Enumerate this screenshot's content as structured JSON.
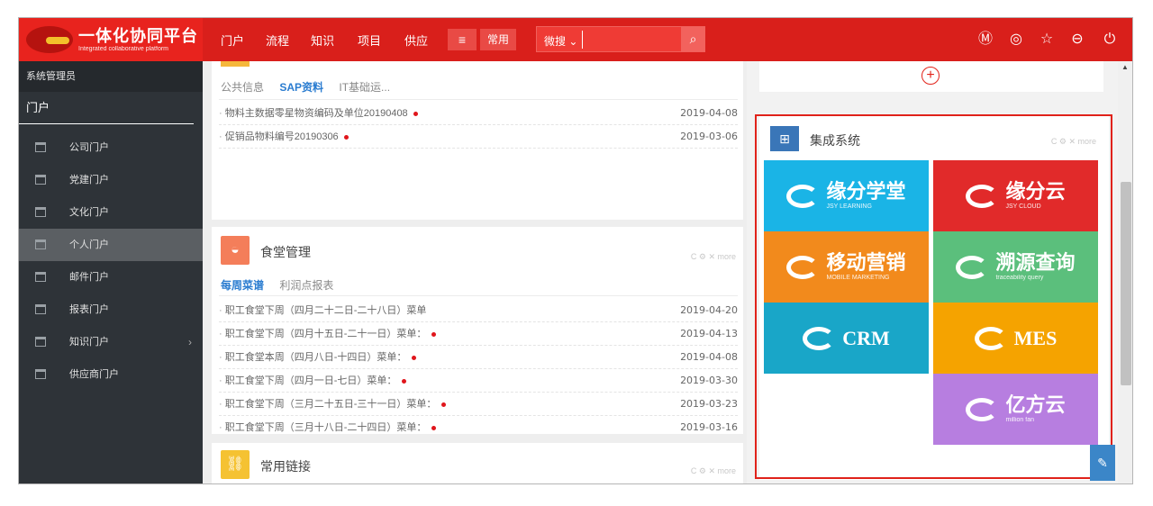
{
  "app": {
    "name_cn": "一体化协同平台",
    "name_en": "Integrated collaborative platform"
  },
  "topnav": {
    "items": [
      "门户",
      "流程",
      "知识",
      "项目",
      "供应"
    ],
    "menu_icon": "hamburger-icon",
    "common_label": "常用",
    "search_scope": "微搜",
    "search_value": "",
    "search_icon": "search-icon",
    "right_icons": [
      "m-circle-icon",
      "settings-circle-icon",
      "star-icon",
      "more-circle-icon",
      "power-icon"
    ]
  },
  "sidebar": {
    "user": "系统管理员",
    "section": "门户",
    "items": [
      {
        "label": "公司门户",
        "icon": "portal-icon"
      },
      {
        "label": "党建门户",
        "icon": "portal-icon"
      },
      {
        "label": "文化门户",
        "icon": "portal-icon"
      },
      {
        "label": "个人门户",
        "icon": "portal-icon"
      },
      {
        "label": "邮件门户",
        "icon": "portal-icon"
      },
      {
        "label": "报表门户",
        "icon": "portal-icon"
      },
      {
        "label": "知识门户",
        "icon": "portal-icon"
      },
      {
        "label": "供应商门户",
        "icon": "portal-icon"
      }
    ],
    "active_index": 3
  },
  "info_panel": {
    "tabs": [
      "公共信息",
      "SAP资料",
      "IT基础运..."
    ],
    "active_tab": 1,
    "rows": [
      {
        "title": "物料主数据零星物资编码及单位20190408",
        "date": "2019-04-08"
      },
      {
        "title": "促销品物料编号20190306",
        "date": "2019-03-06"
      }
    ]
  },
  "canteen_panel": {
    "title": "食堂管理",
    "controls": "C ⚙ ✕ more",
    "tabs": [
      "每周菜谱",
      "利润点报表"
    ],
    "active_tab": 0,
    "rows": [
      {
        "title": "职工食堂下周（四月二十二日-二十八日）菜单",
        "date": "2019-04-20"
      },
      {
        "title": "职工食堂下周（四月十五日-二十一日）菜单：",
        "date": "2019-04-13"
      },
      {
        "title": "职工食堂本周（四月八日-十四日）菜单：",
        "date": "2019-04-08"
      },
      {
        "title": "职工食堂下周（四月一日-七日）菜单：",
        "date": "2019-03-30"
      },
      {
        "title": "职工食堂下周（三月二十五日-三十一日）菜单：",
        "date": "2019-03-23"
      },
      {
        "title": "职工食堂下周（三月十八日-二十四日）菜单：",
        "date": "2019-03-16"
      }
    ]
  },
  "links_panel": {
    "title": "常用链接",
    "controls": "C ⚙ ✕ more"
  },
  "systems_panel": {
    "title": "集成系统",
    "controls": "C ⚙ ✕ more",
    "tiles": [
      {
        "name": "缘分学堂",
        "sub": "JSY LEARNING",
        "color": "#1ab4e6"
      },
      {
        "name": "缘分云",
        "sub": "JSY CLOUD",
        "color": "#e12a2a"
      },
      {
        "name": "移动营销",
        "sub": "MOBILE MARKETING",
        "color": "#f28a1c"
      },
      {
        "name": "溯源查询",
        "sub": "traceability query",
        "color": "#5bbf7c"
      },
      {
        "name": "CRM",
        "sub": "",
        "color": "#19a6c8"
      },
      {
        "name": "MES",
        "sub": "",
        "color": "#f5a300"
      },
      {
        "name": "亿方云",
        "sub": "million fan",
        "color": "#b77ee0"
      }
    ]
  },
  "colors": {
    "brand_red": "#d91f1b",
    "sidebar_bg": "#2e3338",
    "accent_blue": "#2a7cd0",
    "highlight_border": "#e0221a"
  }
}
